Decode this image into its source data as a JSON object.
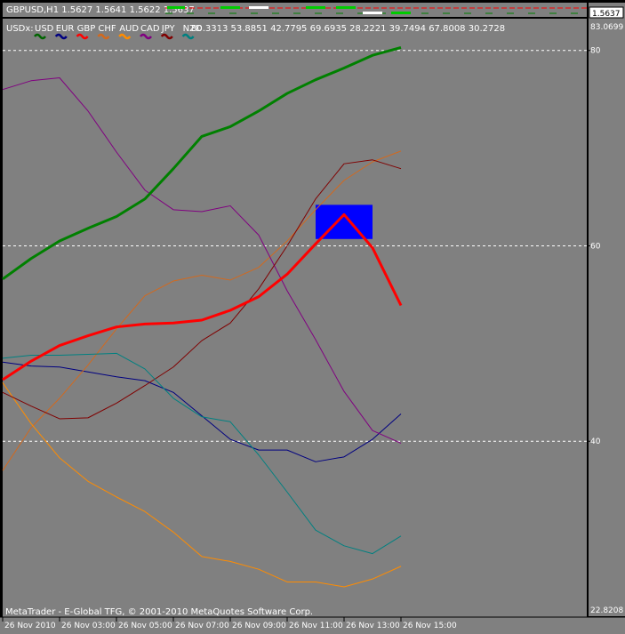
{
  "window": {
    "symbol_line": "GBPUSD,H1  1.5627 1.5641 1.5622 1.5637",
    "price_badge": "1.5637",
    "copyright": "MetaTrader - E-Global TFG, © 2001-2010 MetaQuotes Software Corp."
  },
  "indicator": {
    "name": "USDx:",
    "currencies": [
      "USD",
      "EUR",
      "GBP",
      "CHF",
      "AUD",
      "CAD",
      "JPY",
      "NZD"
    ],
    "colors": [
      "#006400",
      "#000080",
      "#ff0000",
      "#d2691e",
      "#ff8c00",
      "#800080",
      "#800000",
      "#008080"
    ],
    "values_text": "80.3313 53.8851 42.7795 69.6935 28.2221 39.7494 67.8008 30.2728"
  },
  "colors": {
    "background": "#808080",
    "frame": "#000000",
    "text": "#ffffff",
    "grid": "#ffffff",
    "highlight_box": "#0000ff"
  },
  "price_scale": {
    "top_label": "83.0699",
    "bottom_label": "22.8208",
    "levels": [
      "80",
      "60",
      "40"
    ]
  },
  "chart_data": {
    "type": "line",
    "ylim": [
      22.8208,
      83.0699
    ],
    "gridlines": [
      80,
      60,
      40
    ],
    "x_labels": [
      "26 Nov 2010",
      "26 Nov 03:00",
      "26 Nov 05:00",
      "26 Nov 07:00",
      "26 Nov 09:00",
      "26 Nov 11:00",
      "26 Nov 13:00",
      "26 Nov 15:00"
    ],
    "highlight_box": {
      "x_from": 11,
      "x_to": 13,
      "y_from": 60.7,
      "y_to": 64.2
    },
    "series": [
      {
        "name": "USD",
        "color": "#008000",
        "thick": true,
        "values": [
          [
            0,
            56.6
          ],
          [
            1,
            58.7
          ],
          [
            2,
            60.5
          ],
          [
            3,
            61.8
          ],
          [
            4,
            63.0
          ],
          [
            5,
            64.8
          ],
          [
            6,
            67.9
          ],
          [
            7,
            71.2
          ],
          [
            8,
            72.2
          ],
          [
            9,
            73.8
          ],
          [
            10,
            75.6
          ],
          [
            11,
            77.0
          ],
          [
            12,
            78.2
          ],
          [
            13,
            79.5
          ],
          [
            14,
            80.3
          ]
        ]
      },
      {
        "name": "EUR",
        "color": "#000080",
        "values": [
          [
            0,
            48.1
          ],
          [
            1,
            47.7
          ],
          [
            2,
            47.6
          ],
          [
            3,
            47.1
          ],
          [
            4,
            46.6
          ],
          [
            5,
            46.2
          ],
          [
            6,
            45.0
          ],
          [
            7,
            42.6
          ],
          [
            8,
            40.2
          ],
          [
            9,
            39.1
          ],
          [
            10,
            39.1
          ],
          [
            11,
            37.9
          ],
          [
            12,
            38.4
          ],
          [
            13,
            40.2
          ],
          [
            14,
            42.8
          ]
        ]
      },
      {
        "name": "GBP",
        "color": "#ff0000",
        "thick": true,
        "values": [
          [
            0,
            46.3
          ],
          [
            1,
            48.2
          ],
          [
            2,
            49.8
          ],
          [
            3,
            50.8
          ],
          [
            4,
            51.7
          ],
          [
            5,
            52.0
          ],
          [
            6,
            52.1
          ],
          [
            7,
            52.4
          ],
          [
            8,
            53.4
          ],
          [
            9,
            54.8
          ],
          [
            10,
            57.1
          ],
          [
            11,
            60.2
          ],
          [
            12,
            63.2
          ],
          [
            13,
            59.8
          ],
          [
            14,
            53.9
          ]
        ]
      },
      {
        "name": "CHF",
        "color": "#d2691e",
        "values": [
          [
            0,
            37.0
          ],
          [
            1,
            41.4
          ],
          [
            2,
            44.4
          ],
          [
            3,
            47.8
          ],
          [
            4,
            51.5
          ],
          [
            5,
            54.9
          ],
          [
            6,
            56.4
          ],
          [
            7,
            57.0
          ],
          [
            8,
            56.5
          ],
          [
            9,
            57.8
          ],
          [
            10,
            60.5
          ],
          [
            11,
            63.7
          ],
          [
            12,
            66.7
          ],
          [
            13,
            68.6
          ],
          [
            14,
            69.7
          ]
        ]
      },
      {
        "name": "AUD",
        "color": "#ff8c00",
        "values": [
          [
            0,
            46.0
          ],
          [
            1,
            41.8
          ],
          [
            2,
            38.3
          ],
          [
            3,
            35.9
          ],
          [
            4,
            34.3
          ],
          [
            5,
            32.8
          ],
          [
            6,
            30.7
          ],
          [
            7,
            28.2
          ],
          [
            8,
            27.7
          ],
          [
            9,
            26.9
          ],
          [
            10,
            25.6
          ],
          [
            11,
            25.6
          ],
          [
            12,
            25.1
          ],
          [
            13,
            25.9
          ],
          [
            14,
            27.2
          ]
        ]
      },
      {
        "name": "CAD",
        "color": "#800080",
        "values": [
          [
            0,
            76.0
          ],
          [
            1,
            76.9
          ],
          [
            2,
            77.2
          ],
          [
            3,
            73.8
          ],
          [
            4,
            69.6
          ],
          [
            5,
            65.7
          ],
          [
            6,
            63.7
          ],
          [
            7,
            63.5
          ],
          [
            8,
            64.1
          ],
          [
            9,
            61.1
          ],
          [
            10,
            55.4
          ],
          [
            11,
            50.4
          ],
          [
            12,
            45.1
          ],
          [
            13,
            41.1
          ],
          [
            14,
            39.8
          ]
        ]
      },
      {
        "name": "JPY",
        "color": "#800000",
        "values": [
          [
            0,
            45.0
          ],
          [
            1,
            43.6
          ],
          [
            2,
            42.3
          ],
          [
            3,
            42.4
          ],
          [
            4,
            43.9
          ],
          [
            5,
            45.7
          ],
          [
            6,
            47.6
          ],
          [
            7,
            50.3
          ],
          [
            8,
            52.1
          ],
          [
            9,
            55.6
          ],
          [
            10,
            60.0
          ],
          [
            11,
            64.8
          ],
          [
            12,
            68.4
          ],
          [
            13,
            68.8
          ],
          [
            14,
            67.9
          ]
        ]
      },
      {
        "name": "NZD",
        "color": "#008080",
        "values": [
          [
            0,
            48.5
          ],
          [
            1,
            48.8
          ],
          [
            2,
            48.8
          ],
          [
            3,
            48.9
          ],
          [
            4,
            49.0
          ],
          [
            5,
            47.4
          ],
          [
            6,
            44.4
          ],
          [
            7,
            42.5
          ],
          [
            8,
            42.0
          ],
          [
            9,
            38.6
          ],
          [
            10,
            34.8
          ],
          [
            11,
            30.9
          ],
          [
            12,
            29.3
          ],
          [
            13,
            28.5
          ],
          [
            14,
            30.3
          ]
        ]
      }
    ]
  }
}
